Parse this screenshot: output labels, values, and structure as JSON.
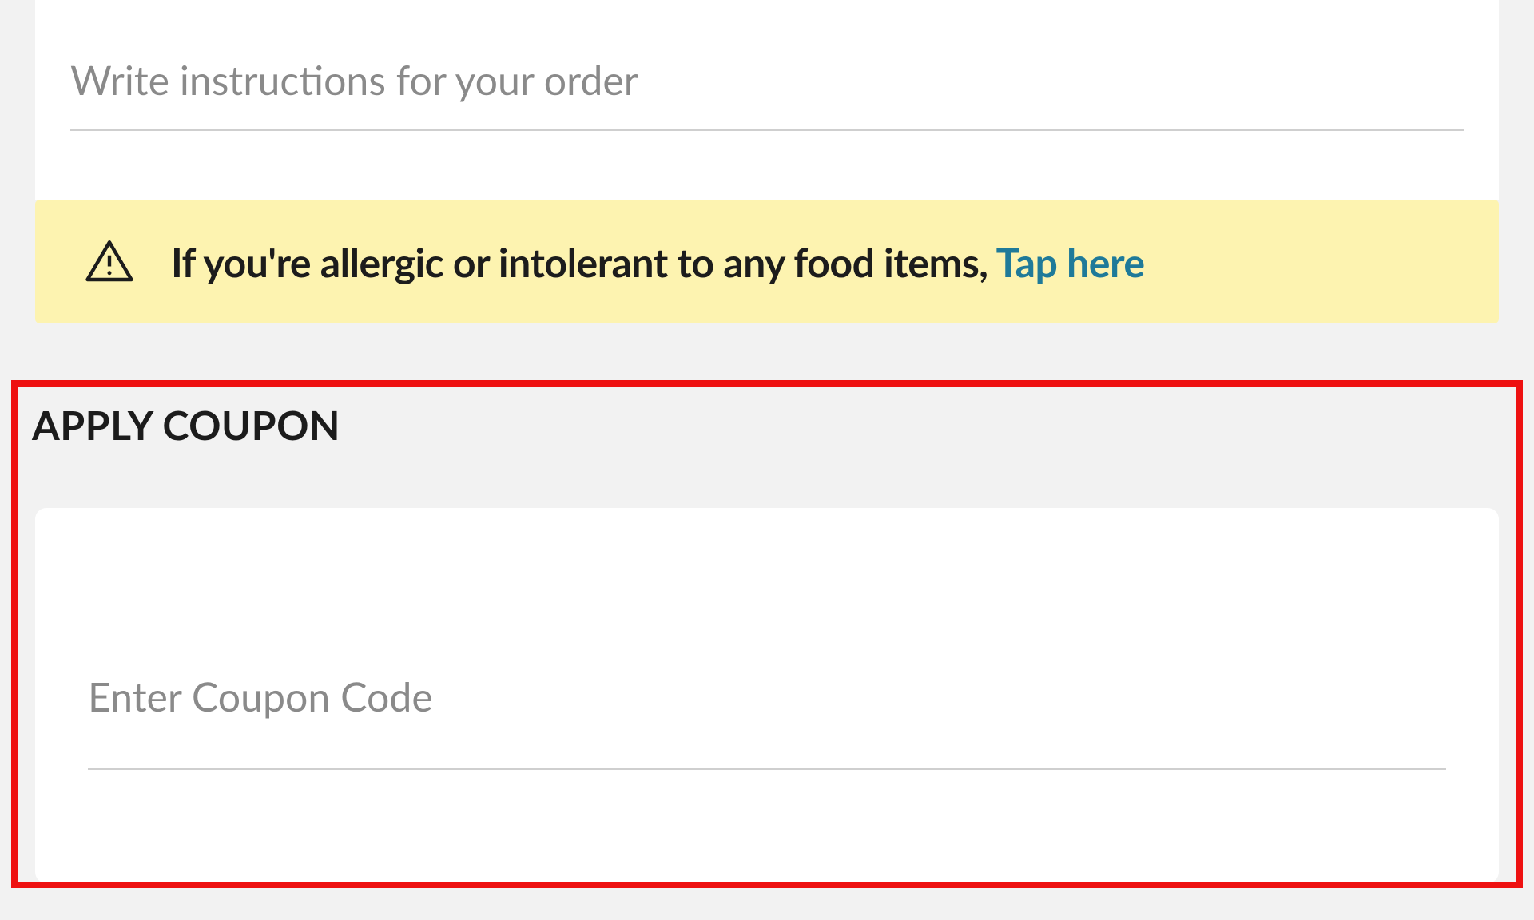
{
  "instructions": {
    "placeholder": "Write instructions for your order",
    "value": ""
  },
  "allergy_banner": {
    "text": "If you're allergic or intolerant to any food items, ",
    "link_text": "Tap here",
    "icon": "warning-triangle-icon"
  },
  "coupon": {
    "heading": "APPLY COUPON",
    "placeholder": "Enter Coupon Code",
    "value": ""
  },
  "colors": {
    "banner_bg": "#fdf3b0",
    "link": "#1f7a99",
    "highlight_border": "#ee1111"
  }
}
